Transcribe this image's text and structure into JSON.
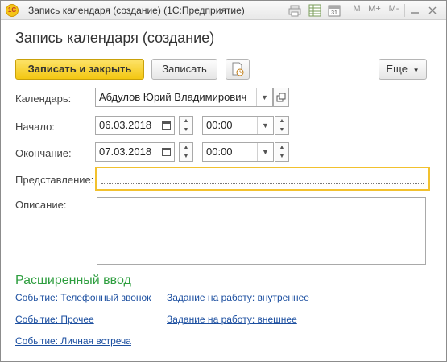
{
  "window": {
    "title": "Запись календаря (создание)  (1С:Предприятие)",
    "app_icon": "1С"
  },
  "toolbar_icons": [
    "print-icon",
    "table-icon",
    "calendar-icon",
    "m-icon",
    "m-plus-icon",
    "m-minus-icon",
    "minimize-icon",
    "maximize-icon",
    "close-icon"
  ],
  "toolbar_labels": {
    "m": "M",
    "m_plus": "M+",
    "m_minus": "M-"
  },
  "form": {
    "title": "Запись календаря (создание)",
    "buttons": {
      "save_close": "Записать и закрыть",
      "save": "Записать",
      "more": "Еще"
    },
    "calendar": {
      "label": "Календарь:",
      "value": "Абдулов Юрий Владимирович"
    },
    "start": {
      "label": "Начало:",
      "date": "06.03.2018",
      "time": "00:00"
    },
    "end": {
      "label": "Окончание:",
      "date": "07.03.2018",
      "time": "00:00"
    },
    "presentation": {
      "label": "Представление:",
      "value": ""
    },
    "description": {
      "label": "Описание:",
      "value": ""
    }
  },
  "extended": {
    "title": "Расширенный ввод",
    "links_left": [
      "Событие: Телефонный звонок",
      "Событие: Прочее",
      "Событие: Личная встреча"
    ],
    "links_right": [
      "Задание на работу: внутреннее",
      "Задание на работу: внешнее"
    ]
  },
  "colors": {
    "accent_yellow": "#f3c712",
    "section_green": "#2e9e3f",
    "link_blue": "#1c4fa0",
    "focus_border": "#f2c12e"
  }
}
